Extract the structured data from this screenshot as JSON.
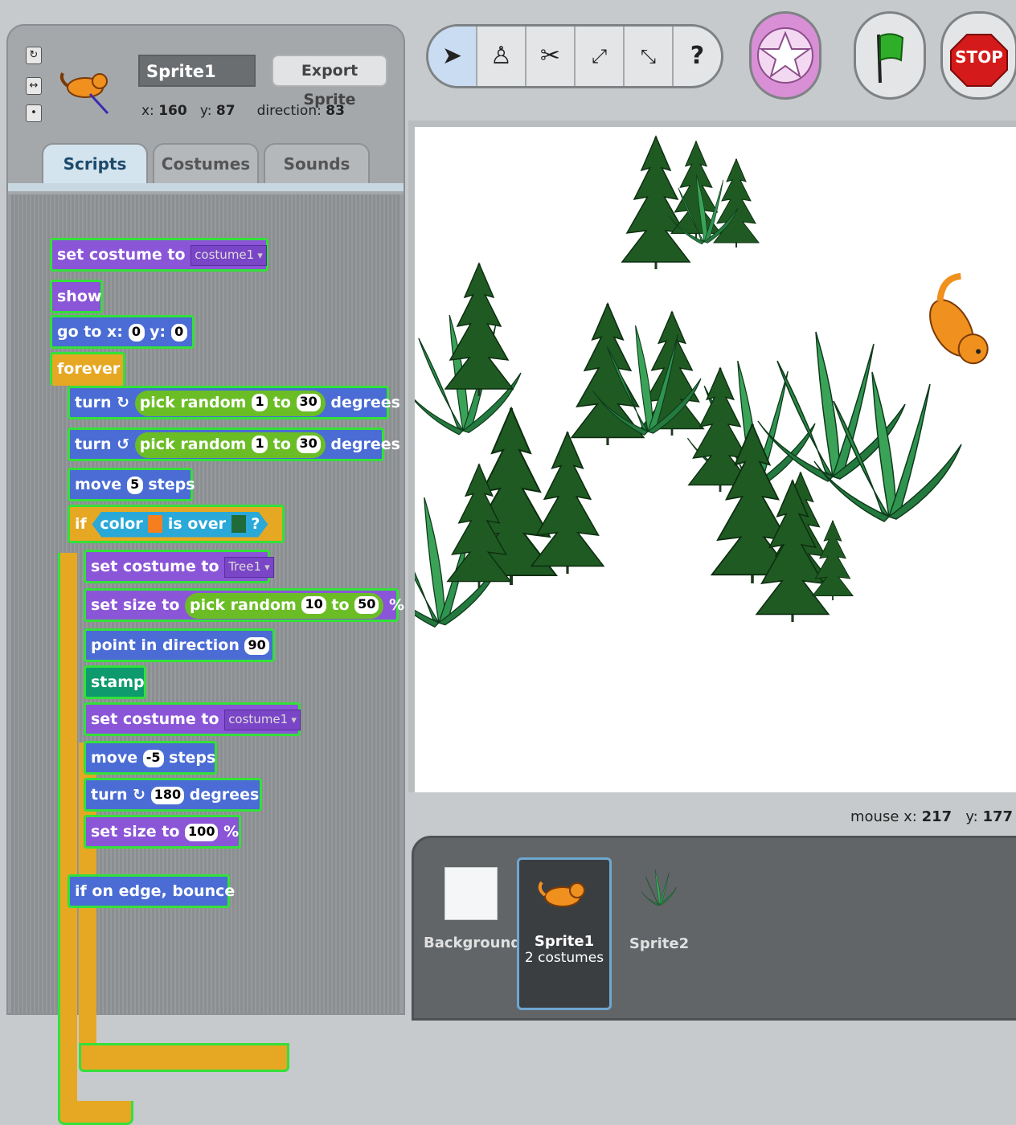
{
  "sprite": {
    "name": "Sprite1",
    "export_label": "Export Sprite",
    "x_label": "x:",
    "x_value": "160",
    "y_label": "y:",
    "y_value": "87",
    "direction_label": "direction:",
    "direction_value": "83"
  },
  "tabs": {
    "scripts": "Scripts",
    "costumes": "Costumes",
    "sounds": "Sounds"
  },
  "blocks": {
    "set_costume_1": {
      "label": "set costume to",
      "value": "costume1"
    },
    "show": "show",
    "goto": {
      "label": "go to x:",
      "x": "0",
      "y_label": "y:",
      "y": "0"
    },
    "forever": "forever",
    "turn_cw": {
      "label": "turn",
      "op": "pick random",
      "from": "1",
      "to_label": "to",
      "to": "30",
      "unit": "degrees"
    },
    "turn_ccw": {
      "label": "turn",
      "op": "pick random",
      "from": "1",
      "to_label": "to",
      "to": "30",
      "unit": "degrees"
    },
    "move_5": {
      "label": "move",
      "value": "5",
      "unit": "steps"
    },
    "if": {
      "label": "if",
      "color_label": "color",
      "is_over": "is over",
      "q": "?"
    },
    "set_costume_tree": {
      "label": "set costume to",
      "value": "Tree1"
    },
    "set_size_random": {
      "label": "set size to",
      "op": "pick random",
      "from": "10",
      "to_label": "to",
      "to": "50",
      "unit": "%"
    },
    "point_dir": {
      "label": "point in direction",
      "value": "90"
    },
    "stamp": "stamp",
    "set_costume_2": {
      "label": "set costume to",
      "value": "costume1"
    },
    "move_neg5": {
      "label": "move",
      "value": "-5",
      "unit": "steps"
    },
    "turn_180": {
      "label": "turn",
      "value": "180",
      "unit": "degrees"
    },
    "set_size_100": {
      "label": "set size to",
      "value": "100",
      "unit": "%"
    },
    "bounce": "if on edge, bounce"
  },
  "toolbar": {
    "stop_label": "STOP"
  },
  "mouse": {
    "x_label": "mouse x:",
    "x_value": "217",
    "y_label": "y:",
    "y_value": "177"
  },
  "sprite_list": [
    {
      "name": "Background",
      "sub": ""
    },
    {
      "name": "Sprite1",
      "sub": "2 costumes"
    },
    {
      "name": "Sprite2",
      "sub": ""
    }
  ],
  "colors": {
    "looks": "#8a55d7",
    "motion": "#4a6cd4",
    "pen": "#0e9a6c",
    "control": "#e6a822",
    "operators": "#6bbd26",
    "sensing": "#2aa9d9",
    "highlight": "#34e03a"
  },
  "icons": [
    "rotate-all-around-icon",
    "left-right-icon",
    "dont-rotate-icon",
    "arrow-cursor-icon",
    "stamp-tool-icon",
    "scissors-icon",
    "grow-icon",
    "shrink-icon",
    "help-icon",
    "presentation-star-icon",
    "green-flag-icon",
    "stop-icon"
  ]
}
